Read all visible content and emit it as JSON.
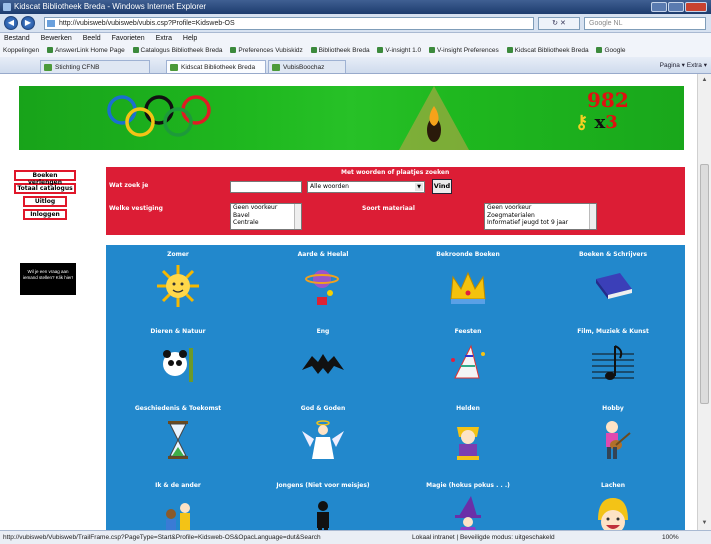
{
  "window": {
    "title": "Kidscat Bibliotheek Breda - Windows Internet Explorer",
    "address": "http://vubisweb/vubisweb/vubis.csp?Profile=Kidsweb-OS",
    "search_placeholder": "Google NL",
    "menu": [
      "Bestand",
      "Bewerken",
      "Beeld",
      "Favorieten",
      "Extra",
      "Help"
    ],
    "favorites": [
      "Koppelingen",
      "AnswerLink Home Page",
      "Catalogus Bibliotheek Breda",
      "Preferences Vubiskidz",
      "Bibliotheek Breda",
      "V-insight 1.0",
      "V-insight Preferences",
      "Kidscat Bibliotheek Breda",
      "Google"
    ],
    "tabs": [
      "Stichting CFNB",
      "Kidscat Bibliotheek Breda",
      "VubisBoochaz"
    ],
    "commands": "Pagina ▾   Extra ▾",
    "status_url": "http://vubisweb/Vubisweb/TrailFrame.csp?PageType=Start&Profile=Kidsweb-OS&OpacLanguage=dut&Search",
    "status_zone": "Lokaal intranet | Beveiligde modus: uitgeschakeld",
    "zoom": "100%"
  },
  "banner": {
    "counter": "982",
    "keys_x": "x",
    "keys_count": "3"
  },
  "leftnav": {
    "items": [
      "Boeken verlengen",
      "Totaal catalogus",
      "Uitlog",
      "Inloggen"
    ],
    "ad_text": "Wil je een vraag aan iemand stellen? Klik hier!"
  },
  "search": {
    "heading": "Met woorden of plaatjes zoeken",
    "what_label": "Wat zoek je",
    "mode_selected": "Alle woorden",
    "submit_label": "Vind",
    "branch_label": "Welke vestiging",
    "branch_options": [
      "Geen voorkeur",
      "Bavel",
      "Centrale"
    ],
    "material_label": "Soort materiaal",
    "material_options": [
      "Geen voorkeur",
      "Zoegmaterialen",
      "Informatief jeugd tot 9 jaar"
    ]
  },
  "categories": [
    {
      "label": "Zomer",
      "icon": "sun-icon"
    },
    {
      "label": "Aarde & Heelal",
      "icon": "planet-icon"
    },
    {
      "label": "Bekroonde Boeken",
      "icon": "crown-icon"
    },
    {
      "label": "Boeken & Schrijvers",
      "icon": "book-icon"
    },
    {
      "label": "Dieren & Natuur",
      "icon": "panda-icon"
    },
    {
      "label": "Eng",
      "icon": "bat-icon"
    },
    {
      "label": "Feesten",
      "icon": "party-hat-icon"
    },
    {
      "label": "Film, Muziek & Kunst",
      "icon": "music-note-icon"
    },
    {
      "label": "Geschiedenis & Toekomst",
      "icon": "hourglass-icon"
    },
    {
      "label": "God & Goden",
      "icon": "angel-icon"
    },
    {
      "label": "Helden",
      "icon": "hero-icon"
    },
    {
      "label": "Hobby",
      "icon": "guitar-player-icon"
    },
    {
      "label": "Ik & de ander",
      "icon": "children-icon"
    },
    {
      "label": "Jongens (Niet voor meisjes)",
      "icon": "boy-icon"
    },
    {
      "label": "Magie (hokus pokus . . .)",
      "icon": "witch-icon"
    },
    {
      "label": "Lachen",
      "icon": "laughing-face-icon"
    }
  ]
}
